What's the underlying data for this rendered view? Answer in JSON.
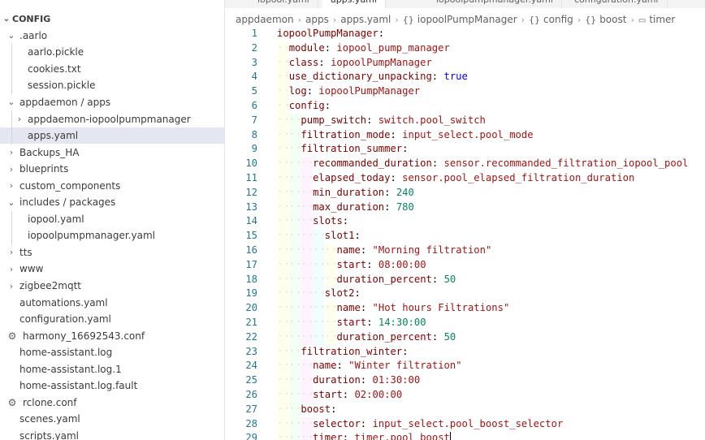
{
  "tabs": [
    {
      "label": "iopool.yaml",
      "active": false
    },
    {
      "label": "apps.yaml",
      "active": true
    },
    {
      "label": "iopoolpumpmanager.yaml",
      "active": false
    },
    {
      "label": "configuration.yaml",
      "active": false
    }
  ],
  "explorer": {
    "section_title": "CONFIG",
    "items": [
      {
        "label": ".aarlo",
        "kind": "folder-open",
        "depth": 0
      },
      {
        "label": "aarlo.pickle",
        "kind": "file",
        "depth": 1
      },
      {
        "label": "cookies.txt",
        "kind": "file",
        "depth": 1
      },
      {
        "label": "session.pickle",
        "kind": "file",
        "depth": 1
      },
      {
        "label": "appdaemon / apps",
        "kind": "folder-open",
        "depth": 0
      },
      {
        "label": "appdaemon-iopoolpumpmanager",
        "kind": "folder",
        "depth": 1
      },
      {
        "label": "apps.yaml",
        "kind": "file",
        "depth": 1,
        "selected": true
      },
      {
        "label": "Backups_HA",
        "kind": "folder",
        "depth": 0
      },
      {
        "label": "blueprints",
        "kind": "folder",
        "depth": 0
      },
      {
        "label": "custom_components",
        "kind": "folder",
        "depth": 0
      },
      {
        "label": "includes / packages",
        "kind": "folder-open",
        "depth": 0
      },
      {
        "label": "iopool.yaml",
        "kind": "file",
        "depth": 1
      },
      {
        "label": "iopoolpumpmanager.yaml",
        "kind": "file",
        "depth": 1
      },
      {
        "label": "tts",
        "kind": "folder",
        "depth": 0
      },
      {
        "label": "www",
        "kind": "folder",
        "depth": 0
      },
      {
        "label": "zigbee2mqtt",
        "kind": "folder",
        "depth": 0
      },
      {
        "label": "automations.yaml",
        "kind": "file",
        "depth": 0
      },
      {
        "label": "configuration.yaml",
        "kind": "file",
        "depth": 0
      },
      {
        "label": "harmony_16692543.conf",
        "kind": "gear-file",
        "depth": 0
      },
      {
        "label": "home-assistant.log",
        "kind": "file",
        "depth": 0
      },
      {
        "label": "home-assistant.log.1",
        "kind": "file",
        "depth": 0
      },
      {
        "label": "home-assistant.log.fault",
        "kind": "file",
        "depth": 0
      },
      {
        "label": "rclone.conf",
        "kind": "gear-file",
        "depth": 0
      },
      {
        "label": "scenes.yaml",
        "kind": "file",
        "depth": 0
      },
      {
        "label": "scripts.yaml",
        "kind": "file",
        "depth": 0
      }
    ]
  },
  "breadcrumb": [
    {
      "label": "appdaemon",
      "icon": ""
    },
    {
      "label": "apps",
      "icon": ""
    },
    {
      "label": "apps.yaml",
      "icon": ""
    },
    {
      "label": "iopoolPumpManager",
      "icon": "{}"
    },
    {
      "label": "config",
      "icon": "{}"
    },
    {
      "label": "boost",
      "icon": "{}"
    },
    {
      "label": "timer",
      "icon": "abc"
    }
  ],
  "code_lines": [
    {
      "n": "1",
      "indent": 0,
      "key": "iopoolPumpManager",
      "value": "",
      "vtype": ""
    },
    {
      "n": "2",
      "indent": 1,
      "key": "module",
      "value": "iopool_pump_manager",
      "vtype": "s"
    },
    {
      "n": "3",
      "indent": 1,
      "key": "class",
      "value": "iopoolPumpManager",
      "vtype": "s"
    },
    {
      "n": "4",
      "indent": 1,
      "key": "use_dictionary_unpacking",
      "value": "true",
      "vtype": "b"
    },
    {
      "n": "5",
      "indent": 1,
      "key": "log",
      "value": "iopoolPumpManager",
      "vtype": "s"
    },
    {
      "n": "6",
      "indent": 1,
      "key": "config",
      "value": "",
      "vtype": ""
    },
    {
      "n": "7",
      "indent": 2,
      "key": "pump_switch",
      "value": "switch.pool_switch",
      "vtype": "s"
    },
    {
      "n": "8",
      "indent": 2,
      "key": "filtration_mode",
      "value": "input_select.pool_mode",
      "vtype": "s"
    },
    {
      "n": "9",
      "indent": 2,
      "key": "filtration_summer",
      "value": "",
      "vtype": ""
    },
    {
      "n": "10",
      "indent": 3,
      "key": "recommanded_duration",
      "value": "sensor.recommanded_filtration_iopool_pool",
      "vtype": "s"
    },
    {
      "n": "11",
      "indent": 3,
      "key": "elapsed_today",
      "value": "sensor.pool_elapsed_filtration_duration",
      "vtype": "s"
    },
    {
      "n": "12",
      "indent": 3,
      "key": "min_duration",
      "value": "240",
      "vtype": "n"
    },
    {
      "n": "13",
      "indent": 3,
      "key": "max_duration",
      "value": "780",
      "vtype": "n"
    },
    {
      "n": "14",
      "indent": 3,
      "key": "slots",
      "value": "",
      "vtype": ""
    },
    {
      "n": "15",
      "indent": 4,
      "key": "slot1",
      "value": "",
      "vtype": ""
    },
    {
      "n": "16",
      "indent": 5,
      "key": "name",
      "value": "\"Morning filtration\"",
      "vtype": "s"
    },
    {
      "n": "17",
      "indent": 5,
      "key": "start",
      "value": "08:00:00",
      "vtype": "s"
    },
    {
      "n": "18",
      "indent": 5,
      "key": "duration_percent",
      "value": "50",
      "vtype": "n"
    },
    {
      "n": "19",
      "indent": 4,
      "key": "slot2",
      "value": "",
      "vtype": ""
    },
    {
      "n": "20",
      "indent": 5,
      "key": "name",
      "value": "\"Hot hours Filtrations\"",
      "vtype": "s"
    },
    {
      "n": "21",
      "indent": 5,
      "key": "start",
      "value": "14:30:00",
      "vtype": "n"
    },
    {
      "n": "22",
      "indent": 5,
      "key": "duration_percent",
      "value": "50",
      "vtype": "n"
    },
    {
      "n": "23",
      "indent": 2,
      "key": "filtration_winter",
      "value": "",
      "vtype": ""
    },
    {
      "n": "24",
      "indent": 3,
      "key": "name",
      "value": "\"Winter filtration\"",
      "vtype": "s"
    },
    {
      "n": "25",
      "indent": 3,
      "key": "duration",
      "value": "01:30:00",
      "vtype": "s"
    },
    {
      "n": "26",
      "indent": 3,
      "key": "start",
      "value": "02:00:00",
      "vtype": "s"
    },
    {
      "n": "27",
      "indent": 2,
      "key": "boost",
      "value": "",
      "vtype": ""
    },
    {
      "n": "28",
      "indent": 3,
      "key": "selector",
      "value": "input_select.pool_boost_selector",
      "vtype": "s"
    },
    {
      "n": "29",
      "indent": 3,
      "key": "timer",
      "value": "timer.pool_boost",
      "vtype": "s"
    }
  ],
  "colors": {
    "key": "#800000",
    "string": "#a31515",
    "number": "#098658",
    "bool": "#0000ff",
    "line_number": "#237893",
    "selection": "#e4e6f1"
  }
}
